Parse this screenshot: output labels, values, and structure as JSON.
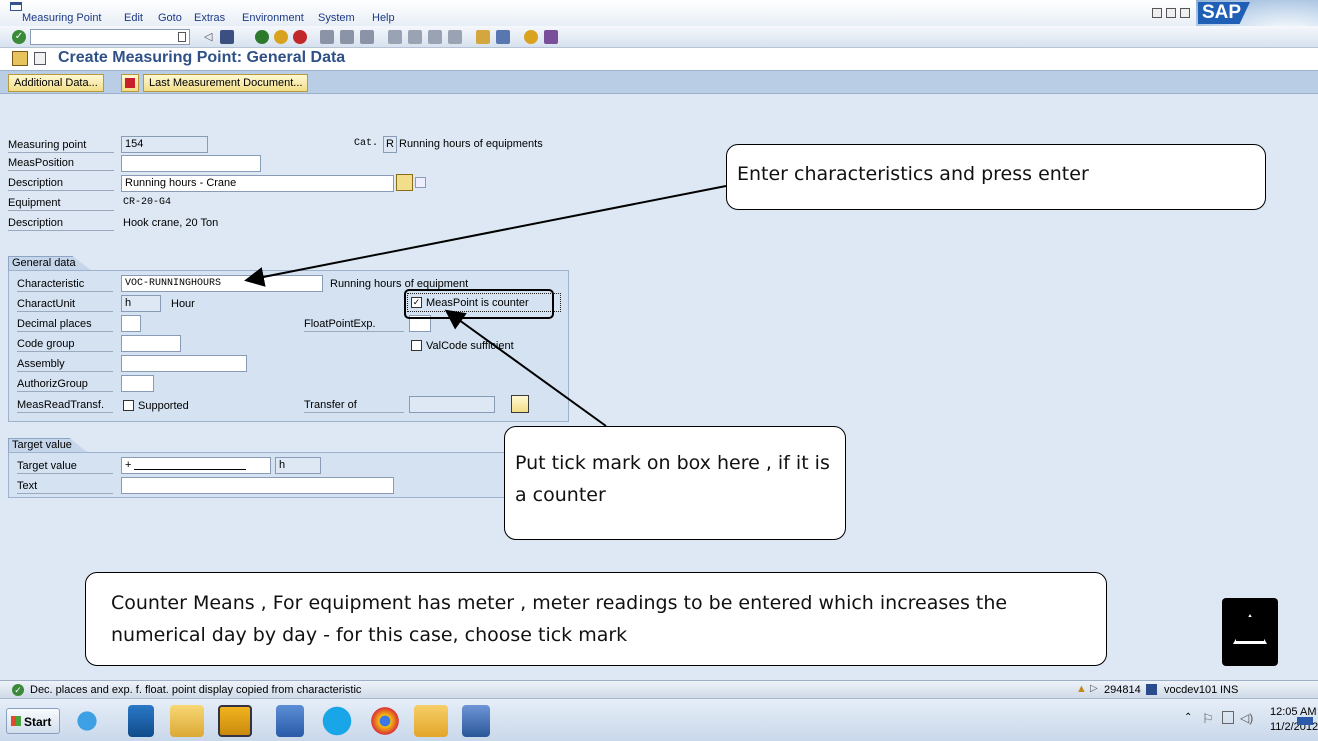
{
  "menu": [
    "Measuring Point",
    "Edit",
    "Goto",
    "Extras",
    "Environment",
    "System",
    "Help"
  ],
  "page_title": "Create Measuring Point: General Data",
  "app_buttons": {
    "additional_data": "Additional Data...",
    "last_doc": "Last Measurement Document..."
  },
  "header": {
    "measuring_point_label": "Measuring point",
    "measuring_point_value": "154",
    "cat_label": "Cat.",
    "cat_value": "R",
    "cat_text": "Running hours of equipments",
    "measposition_label": "MeasPosition",
    "measposition_value": "",
    "description_label": "Description",
    "description_value": "Running hours - Crane",
    "equipment_label": "Equipment",
    "equipment_value": "CR-20-G4",
    "equip_desc_label": "Description",
    "equip_desc_value": "Hook crane, 20 Ton"
  },
  "general": {
    "title": "General data",
    "characteristic_label": "Characteristic",
    "characteristic_value": "VOC-RUNNINGHOURS",
    "characteristic_text": "Running hours of equipment",
    "charactunit_label": "CharactUnit",
    "charactunit_value": "h",
    "charactunit_text": "Hour",
    "counter_label": "MeasPoint is counter",
    "counter_checked": true,
    "decimal_label": "Decimal places",
    "floatpoint_label": "FloatPointExp.",
    "codegroup_label": "Code group",
    "valcode_label": "ValCode sufficient",
    "assembly_label": "Assembly",
    "authgroup_label": "AuthorizGroup",
    "measread_label": "MeasReadTransf.",
    "supported_label": "Supported",
    "transfer_label": "Transfer of"
  },
  "target": {
    "title": "Target value",
    "target_label": "Target value",
    "target_value": "+",
    "target_unit": "h",
    "text_label": "Text"
  },
  "callouts": {
    "c1": "Enter characteristics and press enter",
    "c2": "Put tick mark on box here , if it is a counter",
    "c3": "Counter Means , For equipment has meter , meter readings to be entered which increases the numerical day by day - for this case, choose tick mark"
  },
  "status": {
    "message": "Dec. places and exp. f. float. point display copied from characteristic",
    "session": "294814",
    "system": "vocdev101",
    "mode": "INS"
  },
  "taskbar": {
    "start": "Start",
    "time": "12:05 AM",
    "date": "11/2/2012"
  },
  "colors": {
    "accent": "#1c3a86",
    "content_bg": "#dde8f4",
    "appbar": "#b9cde5"
  }
}
